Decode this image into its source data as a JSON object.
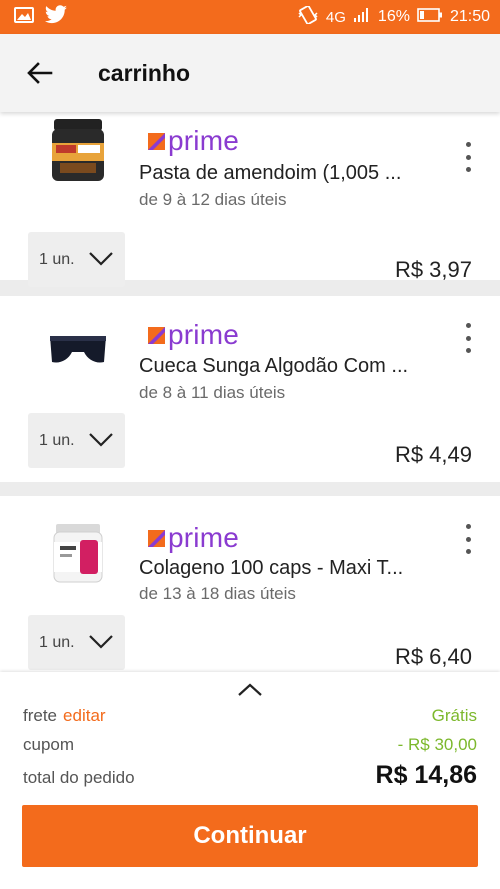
{
  "status_bar": {
    "network": "4G",
    "battery": "16%",
    "time": "21:50"
  },
  "app_bar": {
    "title": "carrinho"
  },
  "cart": {
    "prime_label": "prime",
    "items": [
      {
        "name": "Pasta de amendoim (1,005 ...",
        "delivery": "de 9 à 12 dias úteis",
        "quantity": "1 un.",
        "price": "R$ 3,97"
      },
      {
        "name": "Cueca Sunga Algodão Com ...",
        "delivery": "de 8 à 11 dias úteis",
        "quantity": "1 un.",
        "price": "R$ 4,49"
      },
      {
        "name": "Colageno 100 caps - Maxi T...",
        "delivery": "de 13 à 18 dias úteis",
        "quantity": "1 un.",
        "price": "R$ 6,40"
      }
    ]
  },
  "summary": {
    "shipping_label": "frete",
    "edit_label": "editar",
    "shipping_value": "Grátis",
    "coupon_label": "cupom",
    "coupon_value": "- R$ 30,00",
    "total_label": "total do pedido",
    "total_value": "R$ 14,86",
    "continue_label": "Continuar"
  },
  "colors": {
    "brand_orange": "#f36b1c",
    "prime_purple": "#8a3bd0",
    "free_green": "#7cb82c"
  }
}
